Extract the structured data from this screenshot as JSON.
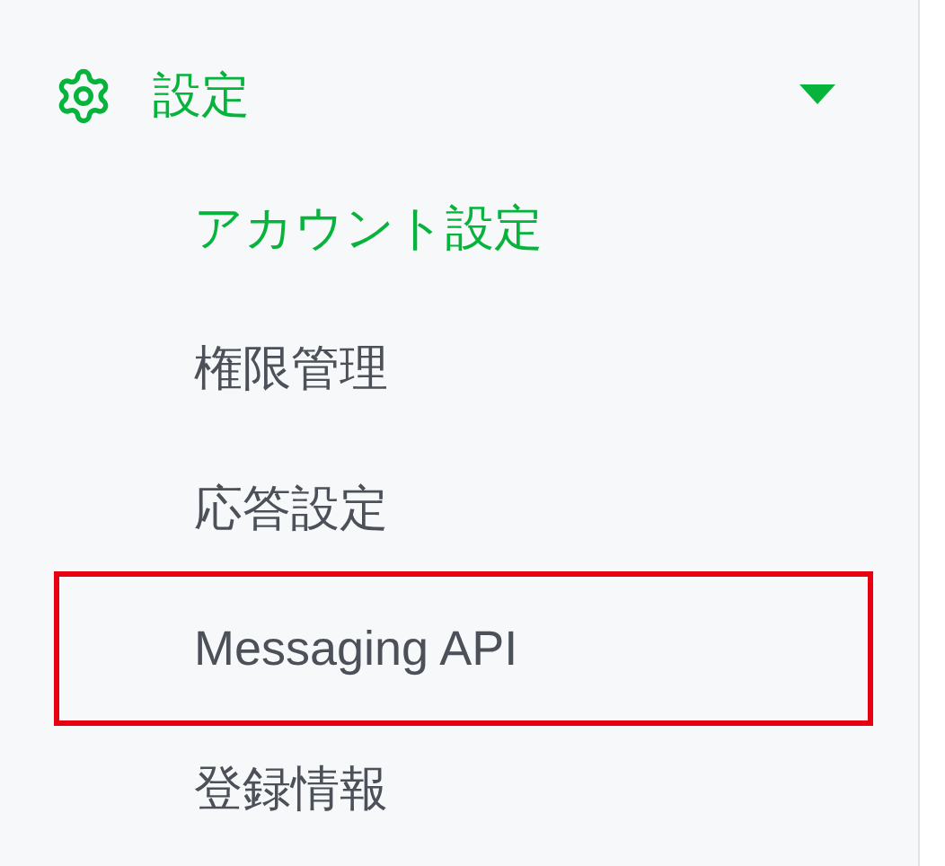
{
  "section": {
    "title": "設定",
    "expanded": true,
    "items": [
      {
        "label": "アカウント設定",
        "selected": true,
        "highlighted": false
      },
      {
        "label": "権限管理",
        "selected": false,
        "highlighted": false
      },
      {
        "label": "応答設定",
        "selected": false,
        "highlighted": false
      },
      {
        "label": "Messaging API",
        "selected": false,
        "highlighted": true
      },
      {
        "label": "登録情報",
        "selected": false,
        "highlighted": false
      }
    ]
  }
}
